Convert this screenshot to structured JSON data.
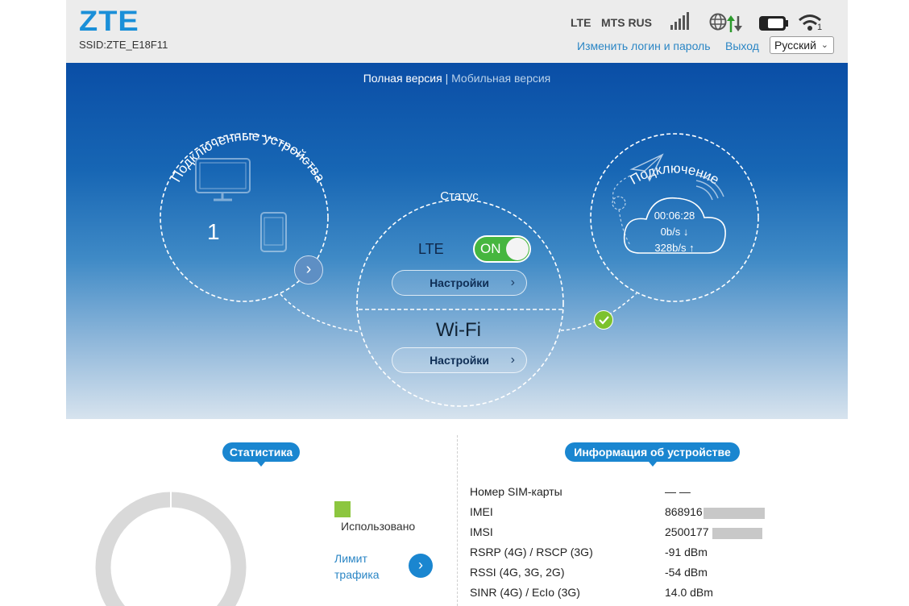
{
  "header": {
    "logo": "ZTE",
    "ssid": "SSID:ZTE_E18F11",
    "network_type": "LTE",
    "operator": "MTS RUS",
    "signal_icon": "signal-bars-icon",
    "data_icon": "globe-updown-icon",
    "battery_icon": "battery-icon",
    "wifi_icon": "wifi-icon",
    "wifi_clients": "1",
    "change_login": "Изменить логин и пароль",
    "logout": "Выход",
    "language": "Русский",
    "colors": {
      "brand": "#1a8fd8",
      "link": "#2b86c5"
    }
  },
  "hero": {
    "full_version": "Полная версия",
    "separator": "|",
    "mobile_version": "Мобильная версия",
    "devices_title": "Подключенные устройства",
    "devices_count": "1",
    "status_title": "Статус",
    "lte_label": "LTE",
    "lte_toggle": "ON",
    "lte_settings": "Настройки",
    "wifi_label": "Wi-Fi",
    "wifi_settings": "Настройки",
    "connection_title": "Подключение",
    "duration": "00:06:28",
    "download": "0b/s ↓",
    "upload": "328b/s ↑"
  },
  "stats": {
    "title": "Статистика",
    "used_label": "Использовано",
    "used_color": "#8cc63f",
    "limit_label_line1": "Лимит",
    "limit_label_line2": "трафика"
  },
  "device_info": {
    "title": "Информация об устройстве",
    "rows": [
      {
        "label": "Номер SIM-карты",
        "value": "— —"
      },
      {
        "label": "IMEI",
        "value": "868916"
      },
      {
        "label": "IMSI",
        "value": "2500177"
      },
      {
        "label": "RSRP (4G) / RSCP (3G)",
        "value": "-91 dBm"
      },
      {
        "label": "RSSI (4G, 3G, 2G)",
        "value": "-54 dBm"
      },
      {
        "label": "SINR (4G) / EcIo (3G)",
        "value": "14.0 dBm"
      }
    ]
  }
}
